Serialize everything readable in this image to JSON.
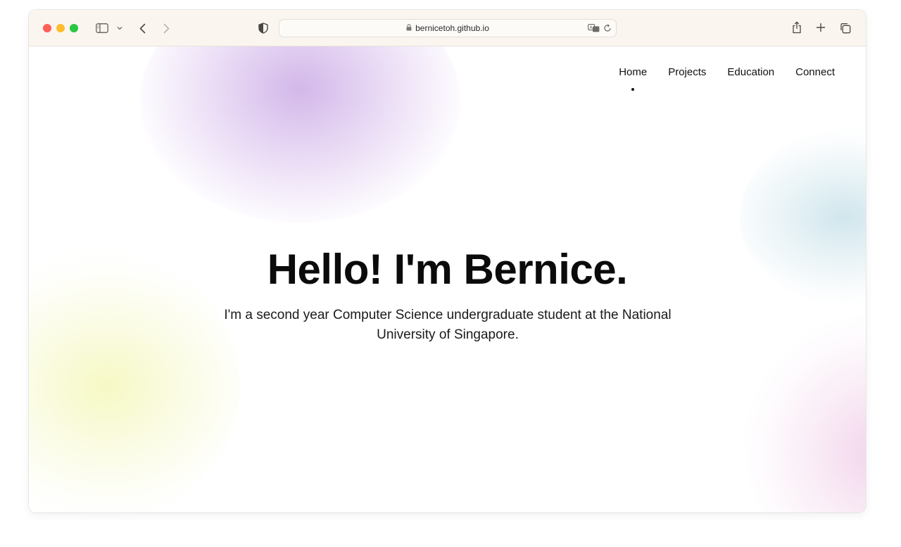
{
  "browser": {
    "url": "bernicetoh.github.io",
    "icons": {
      "sidebar": "sidebar-icon",
      "chevron": "chevron-down-icon",
      "back": "back-icon",
      "forward": "forward-icon",
      "shield": "privacy-shield-icon",
      "lock": "lock-icon",
      "translate": "translate-icon",
      "reload": "reload-icon",
      "share": "share-icon",
      "new_tab": "plus-icon",
      "tabs": "tab-overview-icon"
    }
  },
  "nav": {
    "items": [
      {
        "label": "Home",
        "active": true
      },
      {
        "label": "Projects",
        "active": false
      },
      {
        "label": "Education",
        "active": false
      },
      {
        "label": "Connect",
        "active": false
      }
    ]
  },
  "hero": {
    "title": "Hello! I'm Bernice.",
    "subtitle": "I'm a second year Computer Science undergraduate student at the National University of Singapore."
  },
  "colors": {
    "toolbar_bg": "#faf5ef",
    "close": "#fe5f57",
    "minimize": "#febc2e",
    "maximize": "#28c840",
    "blob_purple": "#c4a0e2",
    "blob_blue": "#c8e2ea",
    "blob_yellow": "#f5f8be",
    "blob_pink": "#f0cde8"
  }
}
